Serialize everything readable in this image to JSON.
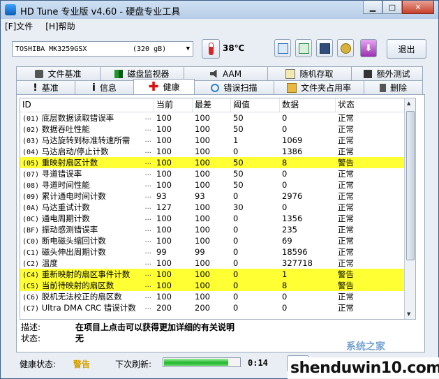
{
  "window": {
    "title": "HD Tune 专业版 v4.60 - 硬盘专业工具"
  },
  "menu": [
    "[F]文件",
    "[H]帮助"
  ],
  "toolbar": {
    "drive_model": "TOSHIBA MK3259GSX",
    "drive_capacity": "(320 gB)",
    "temperature": "38℃",
    "exit_label": "退出",
    "icons": [
      "copy-icon",
      "copy-all-icon",
      "save-icon",
      "settings-icon",
      "download-icon"
    ]
  },
  "tabs_top": [
    {
      "label": "文件基准",
      "icon": "benchmark-icon"
    },
    {
      "label": "磁盘监视器",
      "icon": "monitor-icon"
    },
    {
      "label": "AAM",
      "icon": "speaker-icon"
    },
    {
      "label": "随机存取",
      "icon": "random-access-icon"
    },
    {
      "label": "额外测试",
      "icon": "extra-tests-icon"
    }
  ],
  "tabs_bottom": [
    {
      "label": "基准",
      "icon": "benchmark-icon"
    },
    {
      "label": "信息",
      "icon": "info-icon"
    },
    {
      "label": "健康",
      "icon": "health-icon",
      "active": true
    },
    {
      "label": "错误扫描",
      "icon": "error-scan-icon"
    },
    {
      "label": "文件夹占用率",
      "icon": "folder-usage-icon"
    },
    {
      "label": "删除",
      "icon": "erase-icon"
    }
  ],
  "table": {
    "headers": [
      "ID",
      "当前",
      "最差",
      "阈值",
      "数据",
      "状态"
    ],
    "rows": [
      {
        "code": "(01)",
        "name": "底层数据读取错误率",
        "cur": "100",
        "worst": "100",
        "thr": "50",
        "data": "0",
        "status": "正常",
        "warn": false
      },
      {
        "code": "(02)",
        "name": "数据吞吐性能",
        "cur": "100",
        "worst": "100",
        "thr": "50",
        "data": "0",
        "status": "正常",
        "warn": false
      },
      {
        "code": "(03)",
        "name": "马达旋转到标准转速所需",
        "cur": "100",
        "worst": "100",
        "thr": "1",
        "data": "1069",
        "status": "正常",
        "warn": false
      },
      {
        "code": "(04)",
        "name": "马达启动/停止计数",
        "cur": "100",
        "worst": "100",
        "thr": "0",
        "data": "1386",
        "status": "正常",
        "warn": false
      },
      {
        "code": "(05)",
        "name": "重映射扇区计数",
        "cur": "100",
        "worst": "100",
        "thr": "50",
        "data": "8",
        "status": "警告",
        "warn": true
      },
      {
        "code": "(07)",
        "name": "寻道错误率",
        "cur": "100",
        "worst": "100",
        "thr": "50",
        "data": "0",
        "status": "正常",
        "warn": false
      },
      {
        "code": "(08)",
        "name": "寻道时间性能",
        "cur": "100",
        "worst": "100",
        "thr": "50",
        "data": "0",
        "status": "正常",
        "warn": false
      },
      {
        "code": "(09)",
        "name": "累计通电时间计数",
        "cur": "93",
        "worst": "93",
        "thr": "0",
        "data": "2976",
        "status": "正常",
        "warn": false
      },
      {
        "code": "(0A)",
        "name": "马达重试计数",
        "cur": "127",
        "worst": "100",
        "thr": "30",
        "data": "0",
        "status": "正常",
        "warn": false
      },
      {
        "code": "(0C)",
        "name": "通电周期计数",
        "cur": "100",
        "worst": "100",
        "thr": "0",
        "data": "1356",
        "status": "正常",
        "warn": false
      },
      {
        "code": "(BF)",
        "name": "振动感测错误率",
        "cur": "100",
        "worst": "100",
        "thr": "0",
        "data": "235",
        "status": "正常",
        "warn": false
      },
      {
        "code": "(C0)",
        "name": "断电磁头缩回计数",
        "cur": "100",
        "worst": "100",
        "thr": "0",
        "data": "69",
        "status": "正常",
        "warn": false
      },
      {
        "code": "(C1)",
        "name": "磁头伸出周期计数",
        "cur": "99",
        "worst": "99",
        "thr": "0",
        "data": "18596",
        "status": "正常",
        "warn": false
      },
      {
        "code": "(C2)",
        "name": "温度",
        "cur": "100",
        "worst": "100",
        "thr": "0",
        "data": "327718",
        "status": "正常",
        "warn": false
      },
      {
        "code": "(C4)",
        "name": "重新映射的扇区事件计数",
        "cur": "100",
        "worst": "100",
        "thr": "0",
        "data": "1",
        "status": "警告",
        "warn": true
      },
      {
        "code": "(C5)",
        "name": "当前待映射的扇区数",
        "cur": "100",
        "worst": "100",
        "thr": "0",
        "data": "8",
        "status": "警告",
        "warn": true
      },
      {
        "code": "(C6)",
        "name": "脱机无法校正的扇区数",
        "cur": "100",
        "worst": "100",
        "thr": "0",
        "data": "0",
        "status": "正常",
        "warn": false
      },
      {
        "code": "(C7)",
        "name": "Ultra DMA CRC 错误计数",
        "cur": "200",
        "worst": "200",
        "thr": "0",
        "data": "0",
        "status": "正常",
        "warn": false
      }
    ]
  },
  "description": {
    "label": "描述:",
    "text": "在项目上点击可以获得更加详细的有关说明",
    "status_label": "状态:",
    "status_value": "无"
  },
  "statusbar": {
    "health_label": "健康状态:",
    "health_value": "警告",
    "refresh_label": "下次刷新:",
    "refresh_progress": 0.85,
    "timer": "0:14",
    "button_label": "立"
  },
  "watermark": {
    "text": "shenduwin10.com",
    "small": "系统之家"
  }
}
